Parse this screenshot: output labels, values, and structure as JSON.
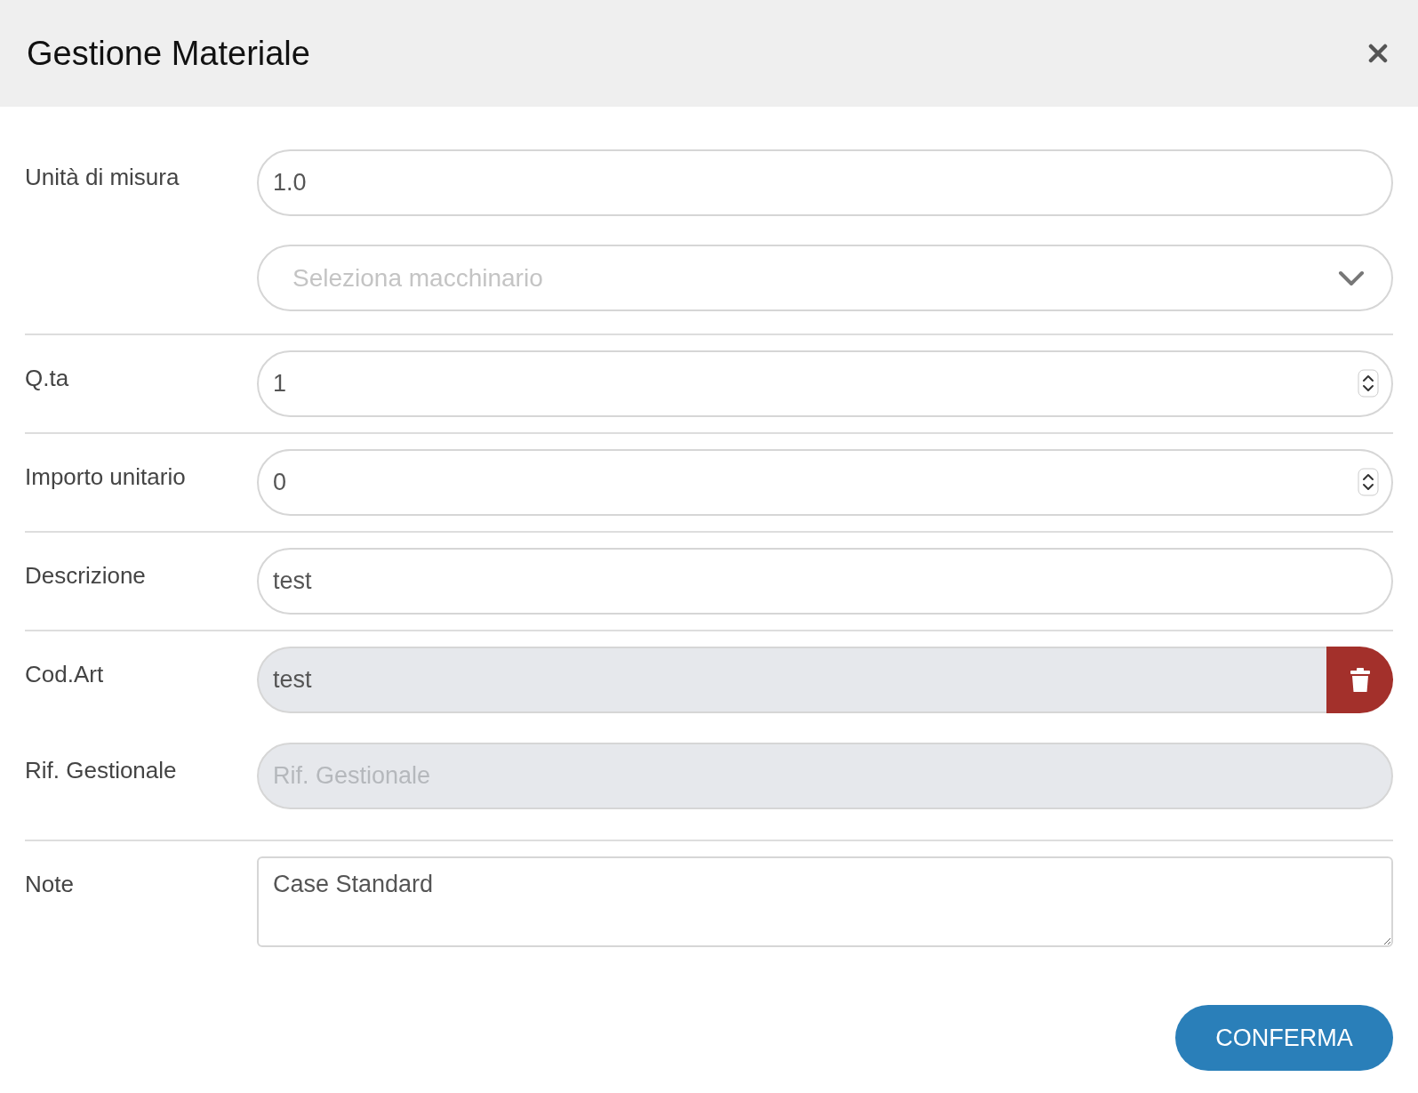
{
  "dialog": {
    "title": "Gestione Materiale"
  },
  "sections": [
    {
      "rows": [
        {
          "label": "Unità di misura",
          "fields": [
            {
              "kind": "text",
              "value": "1.0",
              "disabled": false
            },
            {
              "kind": "select",
              "placeholder": "Seleziona macchinario",
              "disabled": false
            }
          ]
        }
      ]
    },
    {
      "rows": [
        {
          "label": "Q.ta",
          "fields": [
            {
              "kind": "number",
              "value": "1",
              "disabled": false
            }
          ]
        }
      ]
    },
    {
      "rows": [
        {
          "label": "Importo unitario",
          "fields": [
            {
              "kind": "number",
              "value": "0",
              "disabled": false
            }
          ]
        }
      ]
    },
    {
      "rows": [
        {
          "label": "Descrizione",
          "fields": [
            {
              "kind": "text",
              "value": "test",
              "disabled": false
            }
          ]
        }
      ]
    },
    {
      "rows": [
        {
          "label": "Cod.Art",
          "fields": [
            {
              "kind": "text_delete",
              "value": "test",
              "disabled": true
            }
          ]
        },
        {
          "label": "Rif. Gestionale",
          "fields": [
            {
              "kind": "text",
              "placeholder": "Rif. Gestionale",
              "disabled": true
            }
          ]
        }
      ]
    },
    {
      "rows": [
        {
          "label": "Note",
          "fields": [
            {
              "kind": "textarea",
              "value": "Case Standard",
              "disabled": false
            }
          ]
        }
      ]
    }
  ],
  "confirm_button": "CONFERMA"
}
